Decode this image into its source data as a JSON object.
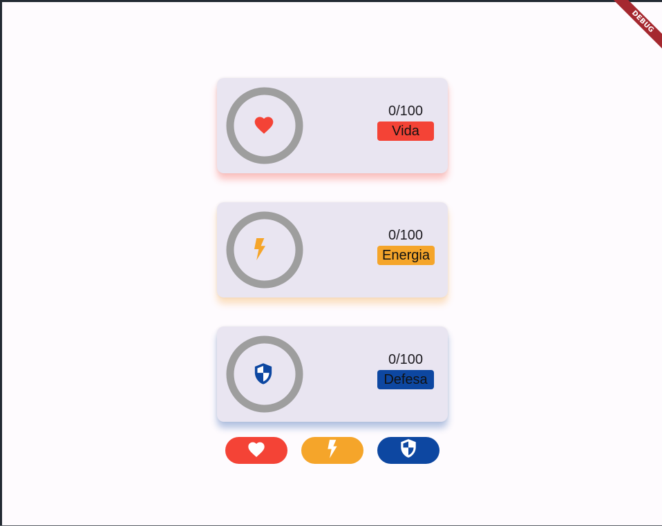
{
  "debug_banner": "DEBUG",
  "colors": {
    "vida": "#f44336",
    "energia": "#f5a52a",
    "defesa": "#0d47a1",
    "ring": "#9e9e9e",
    "card_bg": "#e9e5f1"
  },
  "stats": [
    {
      "key": "vida",
      "label": "Vida",
      "value": "0/100",
      "level": 0,
      "icon": "heart-icon"
    },
    {
      "key": "energia",
      "label": "Energia",
      "value": "0/100",
      "level": 0,
      "icon": "bolt-icon"
    },
    {
      "key": "defesa",
      "label": "Defesa",
      "value": "0/100",
      "level": 0,
      "icon": "shield-icon"
    }
  ],
  "actions": [
    {
      "key": "vida",
      "icon": "heart-icon"
    },
    {
      "key": "energia",
      "icon": "bolt-icon"
    },
    {
      "key": "defesa",
      "icon": "shield-icon"
    }
  ]
}
